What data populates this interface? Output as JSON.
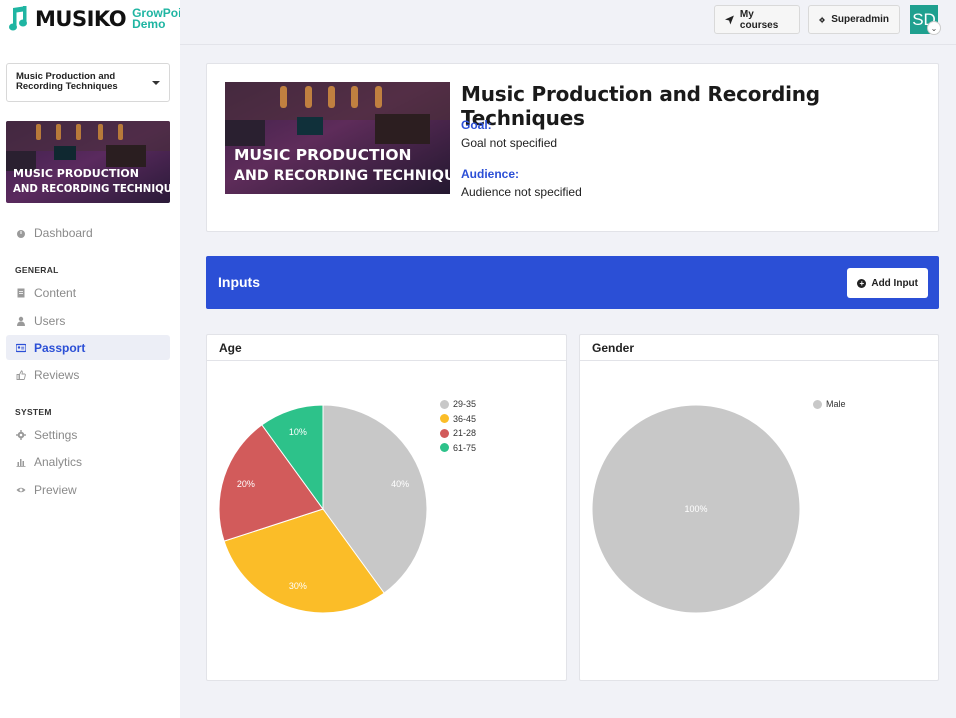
{
  "app": {
    "brand": "MUSIKO",
    "brand_sub_line1": "GrowPoint",
    "brand_sub_line2": "Demo"
  },
  "topbar": {
    "my_courses_label": "My courses",
    "superadmin_label": "Superadmin",
    "avatar_initials": "SD"
  },
  "sidebar": {
    "course_select_value": "Music Production and Recording Techniques",
    "thumb_text_line1": "MUSIC PRODUCTION",
    "thumb_text_line2": "AND RECORDING TECHNIQUES",
    "dashboard_label": "Dashboard",
    "general_heading": "GENERAL",
    "system_heading": "SYSTEM",
    "general_items": [
      {
        "label": "Content",
        "icon": "document-icon"
      },
      {
        "label": "Users",
        "icon": "user-icon"
      },
      {
        "label": "Passport",
        "icon": "id-card-icon",
        "active": true
      },
      {
        "label": "Reviews",
        "icon": "thumbs-up-icon"
      }
    ],
    "system_items": [
      {
        "label": "Settings",
        "icon": "gear-icon"
      },
      {
        "label": "Analytics",
        "icon": "bar-chart-icon"
      },
      {
        "label": "Preview",
        "icon": "eye-icon"
      }
    ]
  },
  "course": {
    "title": "Music Production and Recording Techniques",
    "image_text_line1": "MUSIC PRODUCTION",
    "image_text_line2": "AND RECORDING TECHNIQUES",
    "goal_label": "Goal:",
    "goal_value": "Goal not specified",
    "audience_label": "Audience:",
    "audience_value": "Audience not specified"
  },
  "inputs": {
    "title": "Inputs",
    "add_button_label": "Add Input"
  },
  "colors": {
    "accent": "#2b4fd6",
    "brand_teal": "#1fb5a2"
  },
  "chart_data": [
    {
      "type": "pie",
      "title": "Age",
      "categories": [
        "29-35",
        "36-45",
        "21-28",
        "61-75"
      ],
      "values": [
        40,
        30,
        20,
        10
      ],
      "colors": [
        "#c8c8c8",
        "#fbbd28",
        "#d25b5b",
        "#2dc28a"
      ],
      "data_labels": [
        "40%",
        "30%",
        "20%",
        "10%"
      ],
      "legend_position": "top-right"
    },
    {
      "type": "pie",
      "title": "Gender",
      "categories": [
        "Male"
      ],
      "values": [
        100
      ],
      "colors": [
        "#c8c8c8"
      ],
      "data_labels": [
        "100%"
      ],
      "legend_position": "top-right"
    }
  ]
}
